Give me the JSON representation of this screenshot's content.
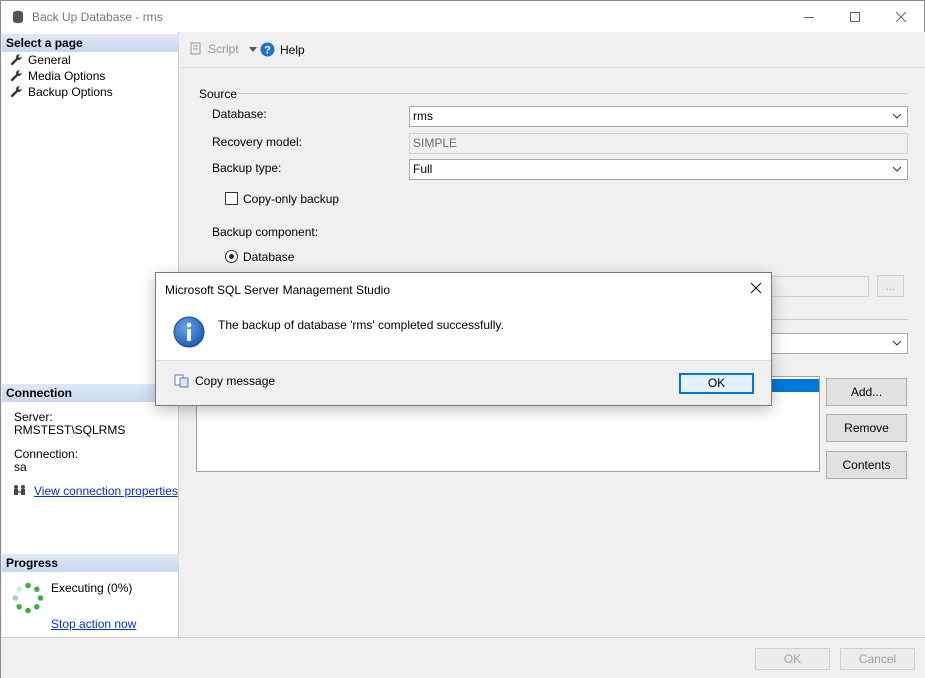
{
  "window": {
    "title": "Back Up Database - rms"
  },
  "left": {
    "select_page_header": "Select a page",
    "pages": [
      {
        "label": "General"
      },
      {
        "label": "Media Options"
      },
      {
        "label": "Backup Options"
      }
    ],
    "connection_header": "Connection",
    "server_label": "Server:",
    "server_value": "RMSTEST\\SQLRMS",
    "connection_label": "Connection:",
    "connection_value": "sa",
    "view_props_link": "View connection properties",
    "progress_header": "Progress",
    "progress_status": "Executing (0%)",
    "progress_percent": 0,
    "stop_link": "Stop action now"
  },
  "toolbar": {
    "script_label": "Script",
    "help_label": "Help"
  },
  "source": {
    "group_label": "Source",
    "database_label": "Database:",
    "database_value": "rms",
    "recovery_label": "Recovery model:",
    "recovery_value": "SIMPLE",
    "backup_type_label": "Backup type:",
    "backup_type_value": "Full",
    "copy_only_label": "Copy-only backup",
    "copy_only_checked": false,
    "component_label": "Backup component:",
    "component_database_label": "Database"
  },
  "side_buttons": {
    "add": "Add...",
    "remove": "Remove",
    "contents": "Contents",
    "browse": "..."
  },
  "bottom": {
    "ok": "OK",
    "cancel": "Cancel"
  },
  "dialog": {
    "title": "Microsoft SQL Server Management Studio",
    "message": "The backup of database 'rms' completed successfully.",
    "copy_message": "Copy message",
    "ok": "OK"
  },
  "colors": {
    "accent": "#0078d7",
    "link": "#0033cc",
    "header_bg": "#c9d8ef",
    "info_icon": "#1f5fb4"
  }
}
